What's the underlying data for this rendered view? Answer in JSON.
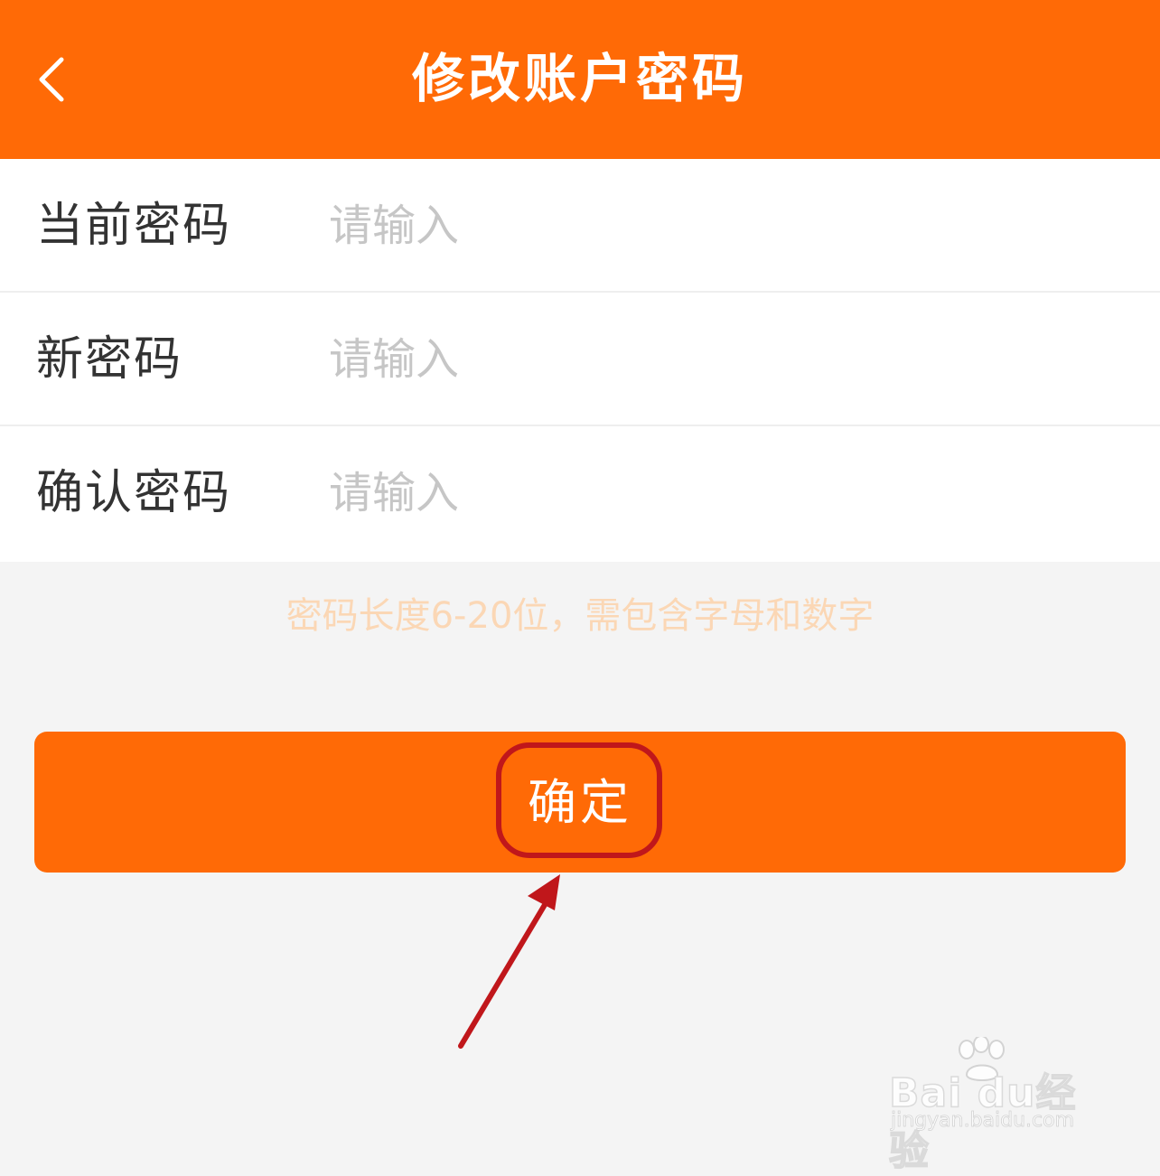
{
  "header": {
    "title": "修改账户密码",
    "back_icon": "chevron-left-icon",
    "color": "#ff6a06"
  },
  "form": {
    "rows": [
      {
        "label": "当前密码",
        "placeholder": "请输入"
      },
      {
        "label": "新密码",
        "placeholder": "请输入"
      },
      {
        "label": "确认密码",
        "placeholder": "请输入"
      }
    ]
  },
  "hint": "密码长度6-20位，需包含字母和数字",
  "confirm_button": {
    "label": "确定",
    "color": "#ff6a06"
  },
  "annotation": {
    "color": "#c0171b"
  },
  "watermark": {
    "brand": "Bai du经验",
    "url": "jingyan.baidu.com"
  }
}
